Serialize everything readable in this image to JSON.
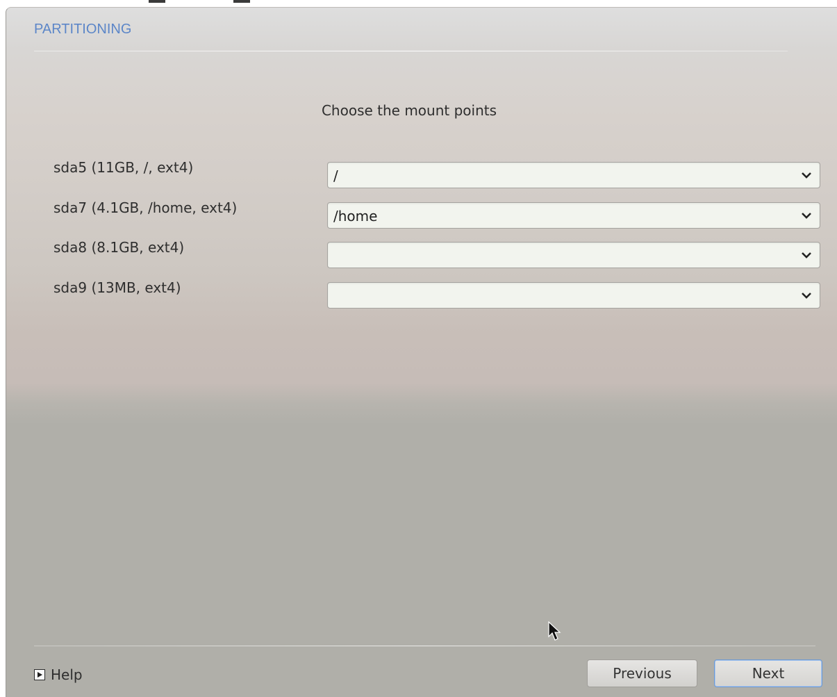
{
  "section_title": "PARTITIONING",
  "prompt": "Choose the mount points",
  "partitions": [
    {
      "label": "sda5 (11GB, /, ext4)",
      "mount_point": "/"
    },
    {
      "label": "sda7 (4.1GB, /home, ext4)",
      "mount_point": "/home"
    },
    {
      "label": "sda8 (8.1GB, ext4)",
      "mount_point": ""
    },
    {
      "label": "sda9 (13MB, ext4)",
      "mount_point": ""
    }
  ],
  "footer": {
    "help_label": "Help",
    "previous_label": "Previous",
    "next_label": "Next"
  },
  "colors": {
    "title_accent": "#5c86c8",
    "default_button_border": "#6b9ad6"
  }
}
